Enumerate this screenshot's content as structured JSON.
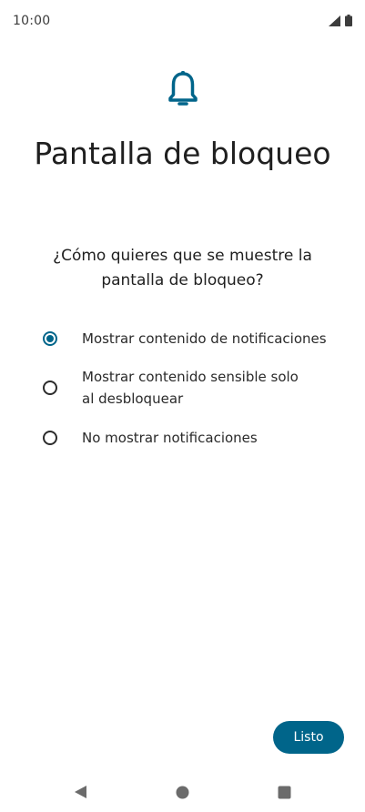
{
  "status_bar": {
    "time": "10:00",
    "icons": [
      "signal-icon",
      "battery-icon"
    ]
  },
  "header": {
    "icon": "bell-icon",
    "title": "Pantalla de bloqueo",
    "subtitle": "¿Cómo quieres que se muestre la pantalla de bloqueo?"
  },
  "options": [
    {
      "label": "Mostrar contenido de notificaciones",
      "selected": true
    },
    {
      "label": "Mostrar contenido sensible solo al desbloquear",
      "selected": false
    },
    {
      "label": "No mostrar notificaciones",
      "selected": false
    }
  ],
  "actions": {
    "done_label": "Listo"
  },
  "nav_bar": {
    "icons": [
      "back-icon",
      "home-icon",
      "recents-icon"
    ]
  },
  "colors": {
    "accent": "#00658a",
    "text": "#1f1f1f",
    "background": "#ffffff"
  }
}
